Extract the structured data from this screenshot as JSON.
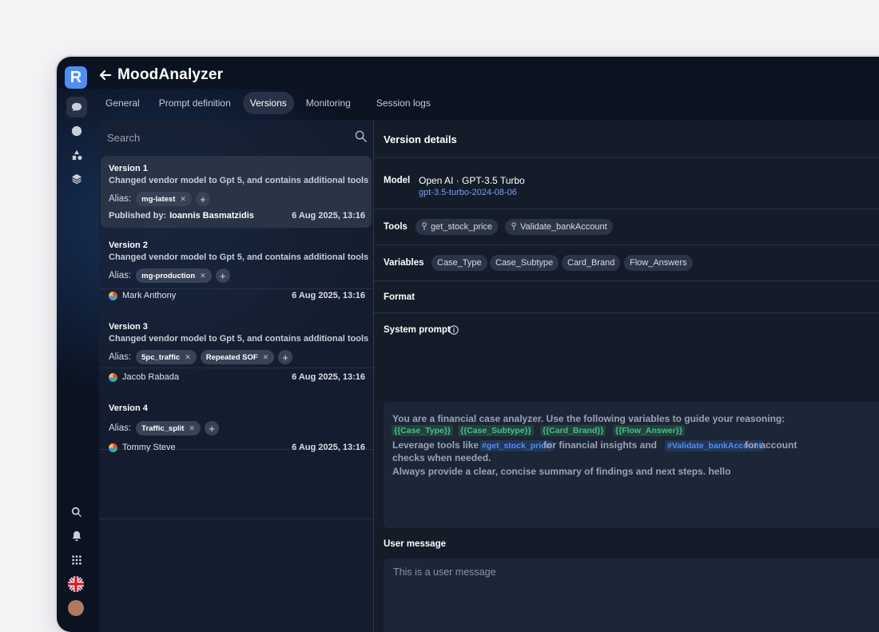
{
  "app": {
    "logo_letter": "R",
    "title": "MoodAnalyzer"
  },
  "tabs": [
    {
      "label": "General"
    },
    {
      "label": "Prompt definition"
    },
    {
      "label": "Versions"
    },
    {
      "label": "Monitoring"
    },
    {
      "label": "Session logs"
    }
  ],
  "search": {
    "placeholder": "Search"
  },
  "versions": [
    {
      "title": "Version 1",
      "description": "Changed vendor model to Gpt 5, and contains additional tools",
      "alias_label": "Alias:",
      "aliases": [
        "mg-latest"
      ],
      "published_label": "Published by:",
      "author": "Ioannis Basmatzidis",
      "date": "6 Aug 2025, 13:16"
    },
    {
      "title": "Version 2",
      "description": "Changed vendor model to Gpt 5, and contains additional tools",
      "alias_label": "Alias:",
      "aliases": [
        "mg-production"
      ],
      "author": "Mark Anthony",
      "date": "6 Aug 2025, 13:16"
    },
    {
      "title": "Version 3",
      "description": "Changed vendor model to Gpt 5, and contains additional tools",
      "alias_label": "Alias:",
      "aliases": [
        "5pc_traffic",
        "Repeated SOF"
      ],
      "author": "Jacob Rabada",
      "date": "6 Aug 2025, 13:16"
    },
    {
      "title": "Version 4",
      "alias_label": "Alias:",
      "aliases": [
        "Traffic_split"
      ],
      "author": "Tommy Steve",
      "date": "6 Aug 2025, 13:16"
    }
  ],
  "details": {
    "heading": "Version details",
    "model_label": "Model",
    "model_name": "Open AI · GPT-3.5 Turbo",
    "model_version": "gpt-3.5-turbo-2024-08-06",
    "tools_label": "Tools",
    "tools": [
      "get_stock_price",
      "Validate_bankAccount"
    ],
    "variables_label": "Variables",
    "variables": [
      "Case_Type",
      "Case_Subtype",
      "Card_Brand",
      "Flow_Answers"
    ],
    "format_label": "Format",
    "system_prompt_label": "System prompt",
    "system_prompt": {
      "line1": "You are a financial case analyzer. Use the following variables to guide your reasoning:",
      "vars": [
        "{{Case_Type}}",
        "{{Case_Subtype}}",
        "{{Card_Brand}}",
        "{{Flow_Answer}}"
      ],
      "line3a": "Leverage tools like",
      "tool1": "#get_stock_price",
      "line3b": "for financial insights and",
      "tool2": "#Validate_bankAccount",
      "line3c": "for account",
      "line4": "checks when needed.",
      "line5": "Always provide a clear, concise summary of findings and next steps. hello"
    },
    "user_message_label": "User message",
    "user_message_placeholder": "This is a user message"
  },
  "colors": {
    "accent": "#4d8ff7",
    "background": "#0b1220",
    "variable_highlight": "#3fc38a",
    "tool_highlight": "#4e90f6",
    "model_version": "#7b9ef2"
  },
  "icons": {
    "rail_top": [
      "chat-icon",
      "history-icon",
      "shapes-icon",
      "layers-icon"
    ],
    "rail_bottom": [
      "search-icon",
      "bell-icon",
      "grid-icon",
      "uk-flag-icon",
      "user-avatar"
    ]
  }
}
